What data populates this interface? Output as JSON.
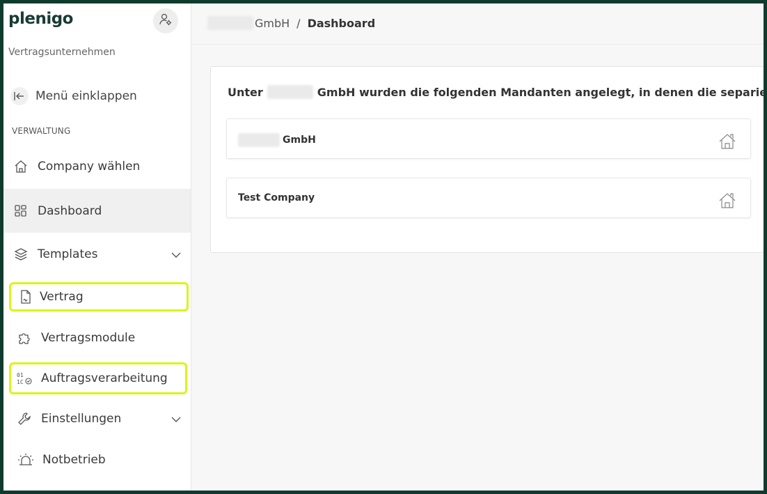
{
  "brand": {
    "logo": "plenigo",
    "subtitle": "Vertragsunternehmen"
  },
  "sidebar": {
    "collapse_label": "Menü einklappen",
    "section_title": "VERWALTUNG",
    "items": [
      {
        "label": "Company wählen",
        "icon": "home-icon"
      },
      {
        "label": "Dashboard",
        "icon": "grid-icon"
      },
      {
        "label": "Templates",
        "icon": "layers-icon"
      },
      {
        "label": "Vertrag",
        "icon": "document-icon"
      },
      {
        "label": "Vertragsmodule",
        "icon": "puzzle-icon"
      },
      {
        "label": "Auftragsverarbeitung",
        "icon": "binary-check-icon"
      },
      {
        "label": "Einstellungen",
        "icon": "wrench-icon"
      },
      {
        "label": "Notbetrieb",
        "icon": "alarm-icon"
      }
    ]
  },
  "breadcrumb": {
    "company_suffix": "GmbH",
    "separator": "/",
    "current": "Dashboard"
  },
  "main": {
    "intro_prefix": "Unter",
    "intro_rest": "GmbH wurden die folgenden Mandanten angelegt, in denen die separierten Ar",
    "tenants": [
      {
        "name": "GmbH"
      },
      {
        "name": "Test Company"
      }
    ]
  },
  "colors": {
    "highlight": "#d9f51b",
    "frame": "#0f3b2e",
    "brand": "#183c34"
  }
}
